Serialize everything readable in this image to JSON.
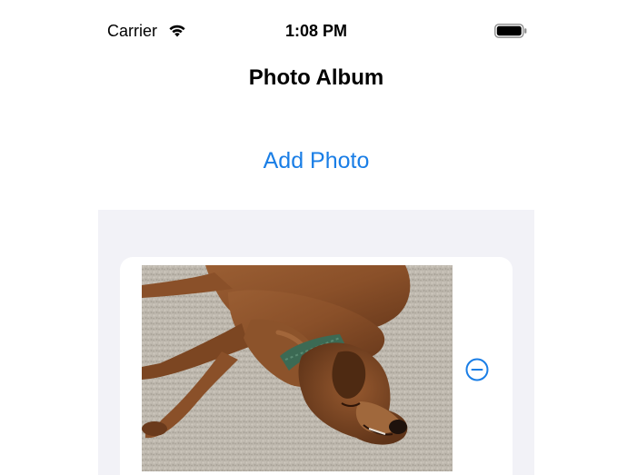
{
  "status_bar": {
    "carrier": "Carrier",
    "time": "1:08 PM",
    "wifi_icon": "wifi-icon",
    "battery_icon": "battery-icon"
  },
  "nav": {
    "title": "Photo Album"
  },
  "actions": {
    "add_photo_label": "Add Photo"
  },
  "photos": [
    {
      "subject": "sleeping brown dog on carpet",
      "remove_icon": "minus-circle-icon"
    }
  ],
  "colors": {
    "accent": "#1a7ee6",
    "grouped_background": "#f2f2f7",
    "card_background": "#ffffff"
  }
}
